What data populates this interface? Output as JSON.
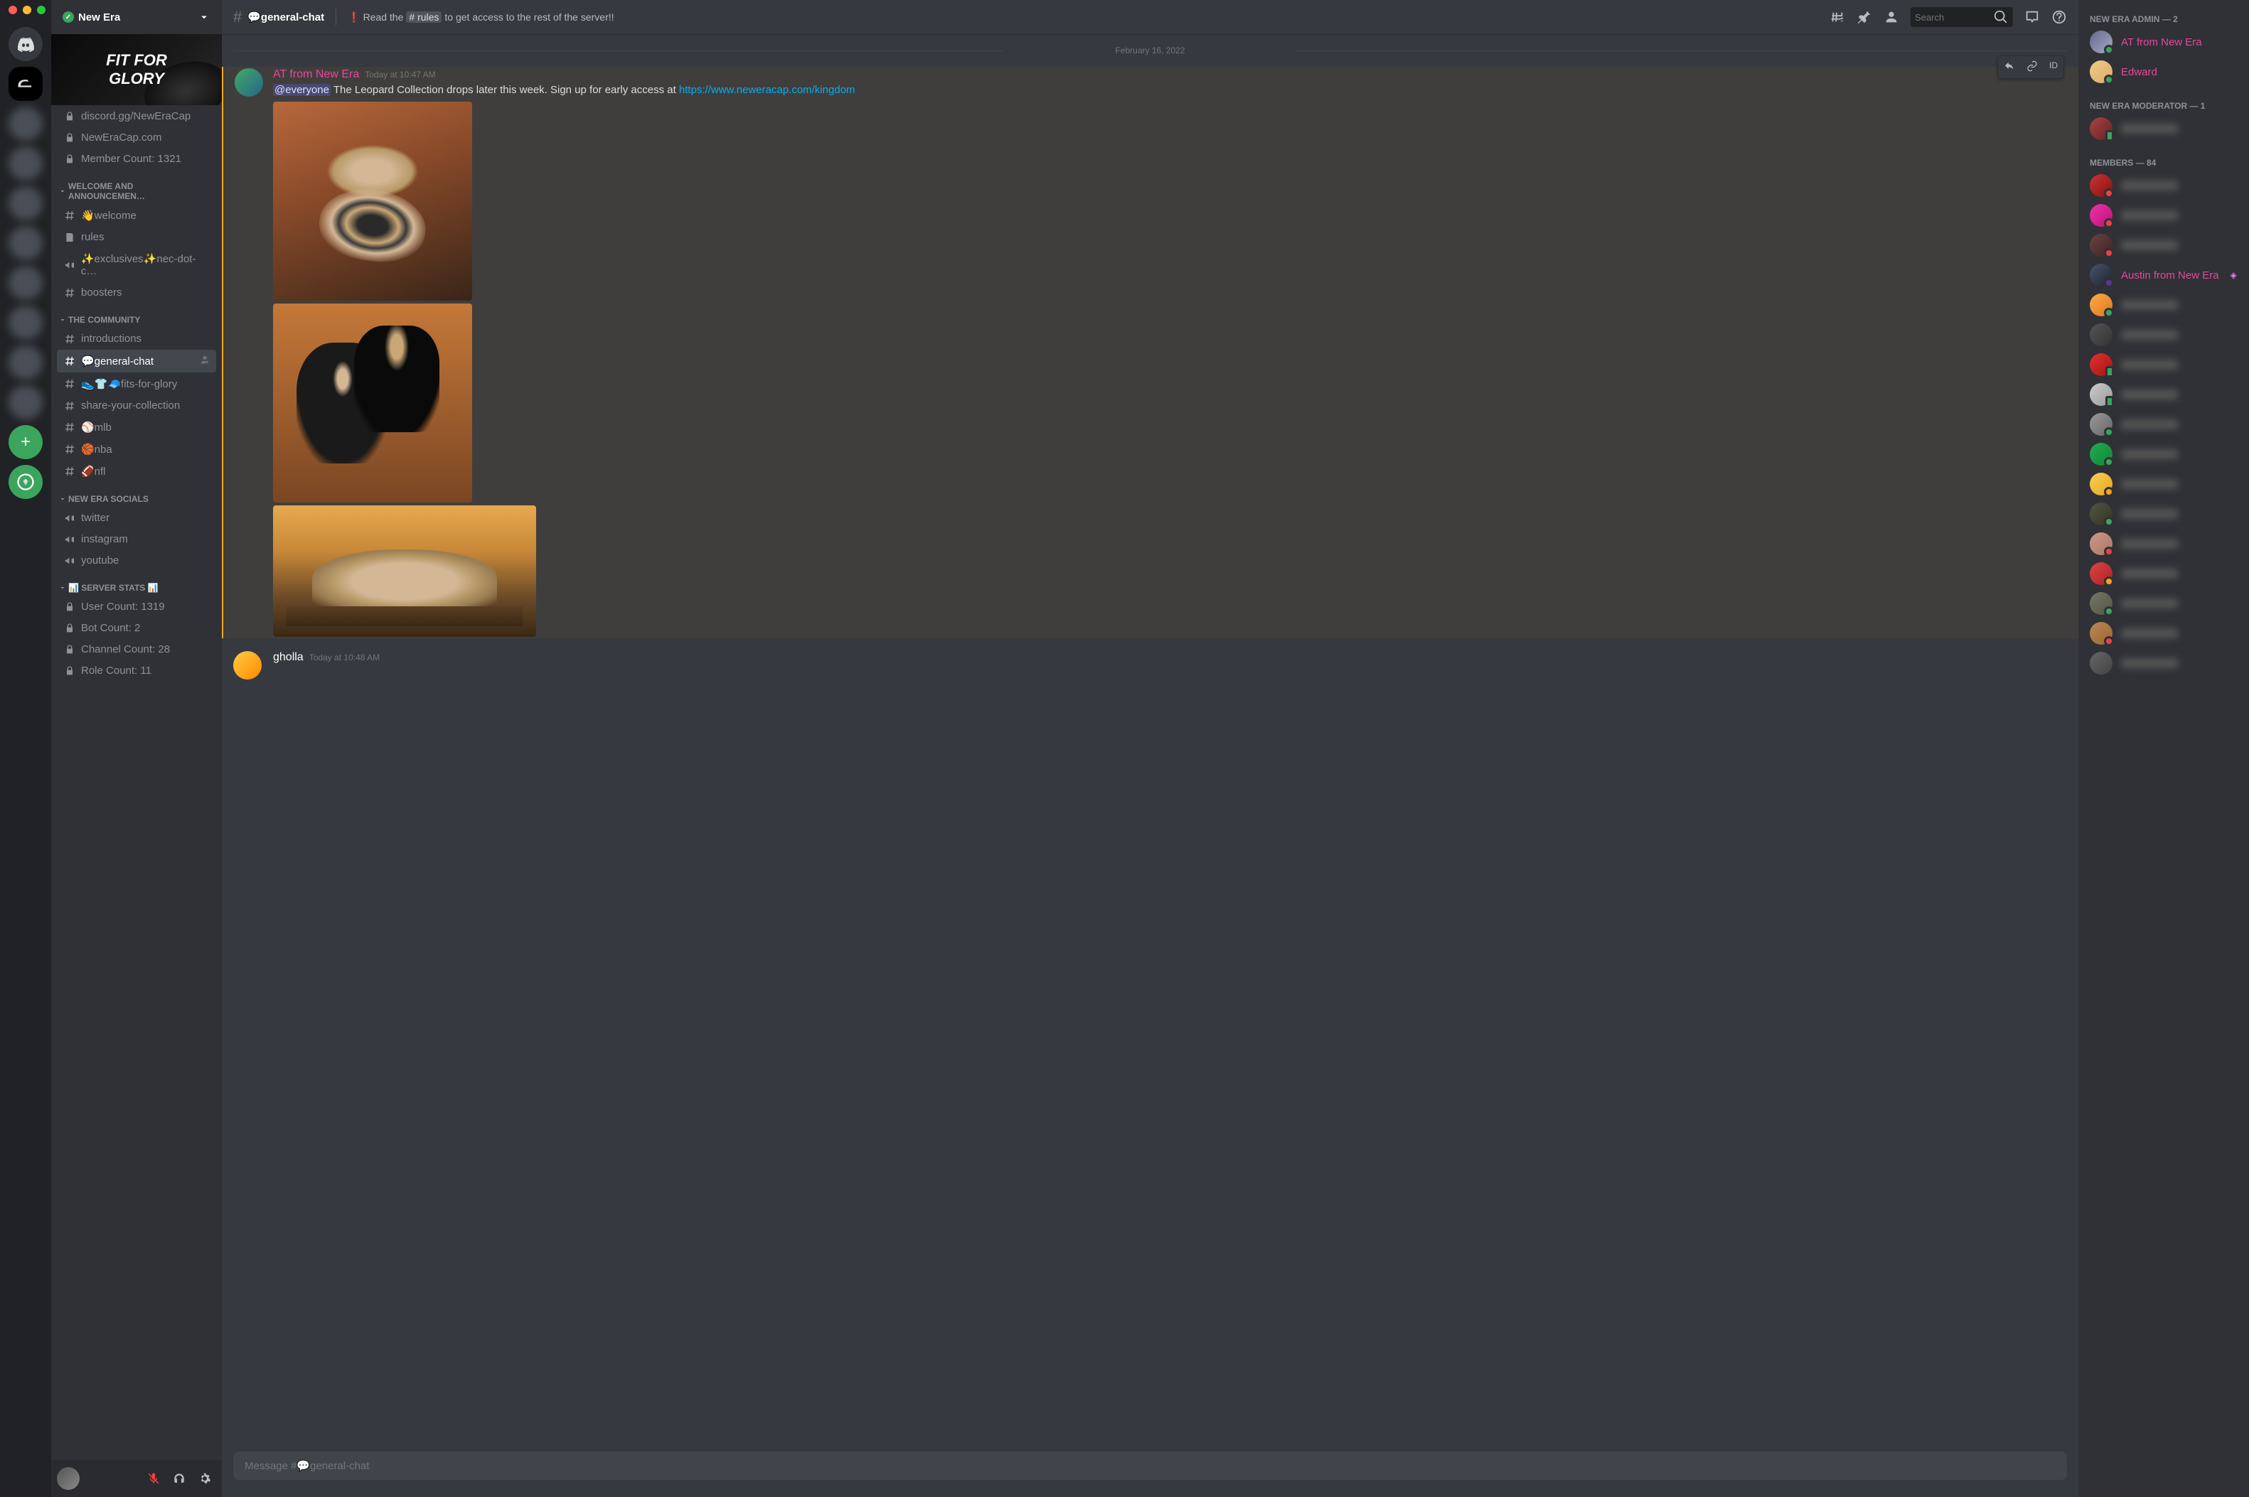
{
  "window": {
    "server_name": "New Era"
  },
  "banner_text": "FIT FOR\nGLORY",
  "categories": [
    {
      "name": "",
      "channels": [
        {
          "label": "discord.gg/NewEraCap",
          "icon": "lock"
        },
        {
          "label": "NewEraCap.com",
          "icon": "lock"
        },
        {
          "label": "Member Count: 1321",
          "icon": "lock"
        }
      ]
    },
    {
      "name": "WELCOME AND ANNOUNCEMEN…",
      "channels": [
        {
          "label": "👋welcome",
          "icon": "hash"
        },
        {
          "label": "rules",
          "icon": "rules"
        },
        {
          "label": "✨exclusives✨nec-dot-c…",
          "icon": "mega"
        },
        {
          "label": "boosters",
          "icon": "hash"
        }
      ]
    },
    {
      "name": "THE COMMUNITY",
      "channels": [
        {
          "label": "introductions",
          "icon": "hash"
        },
        {
          "label": "💬general-chat",
          "icon": "hash",
          "selected": true,
          "add": true
        },
        {
          "label": "👟👕🧢fits-for-glory",
          "icon": "hash"
        },
        {
          "label": "share-your-collection",
          "icon": "hash"
        },
        {
          "label": "⚾mlb",
          "icon": "hash"
        },
        {
          "label": "🏀nba",
          "icon": "hash"
        },
        {
          "label": "🏈nfl",
          "icon": "hash"
        }
      ]
    },
    {
      "name": "NEW ERA SOCIALS",
      "channels": [
        {
          "label": "twitter",
          "icon": "mega"
        },
        {
          "label": "instagram",
          "icon": "mega"
        },
        {
          "label": "youtube",
          "icon": "mega"
        }
      ]
    },
    {
      "name": "📊 SERVER STATS 📊",
      "channels": [
        {
          "label": "User Count: 1319",
          "icon": "lock"
        },
        {
          "label": "Bot Count: 2",
          "icon": "lock"
        },
        {
          "label": "Channel Count: 28",
          "icon": "lock"
        },
        {
          "label": "Role Count: 11",
          "icon": "lock"
        }
      ]
    }
  ],
  "header": {
    "channel": "💬general-chat",
    "topic_pre": "Read the",
    "topic_tag": "# rules",
    "topic_post": "to get access to the rest of the server!!",
    "search_placeholder": "Search"
  },
  "divider_date": "February 16, 2022",
  "message1": {
    "author": "AT from New Era",
    "timestamp": "Today at 10:47 AM",
    "mention": "@everyone",
    "body": " The Leopard Collection drops later this week. Sign up for early access at ",
    "link": "https://www.neweracap.com/kingdom"
  },
  "message2": {
    "author": "gholla",
    "timestamp": "Today at 10:48 AM"
  },
  "input_placeholder": "Message #💬general-chat",
  "member_groups": [
    {
      "title": "NEW ERA ADMIN — 2",
      "members": [
        {
          "name": "AT from New Era",
          "color": "pink",
          "status": "on",
          "av": "linear-gradient(135deg,#668,#aac)"
        },
        {
          "name": "Edward",
          "color": "pink",
          "status": "on",
          "av": "linear-gradient(135deg,#ec8,#da6)"
        }
      ]
    },
    {
      "title": "NEW ERA MODERATOR — 1",
      "members": [
        {
          "name": "",
          "blur": true,
          "status": "mob",
          "av": "linear-gradient(135deg,#a44,#622)"
        }
      ]
    },
    {
      "title": "MEMBERS — 84",
      "members": [
        {
          "blur": true,
          "status": "dnd",
          "av": "linear-gradient(135deg,#c33,#811)"
        },
        {
          "blur": true,
          "status": "dnd",
          "av": "linear-gradient(135deg,#e3a,#b17)"
        },
        {
          "blur": true,
          "status": "dnd",
          "av": "linear-gradient(135deg,#644,#422)"
        },
        {
          "name": "Austin from New Era",
          "color": "pink",
          "status": "stream",
          "nitro": true,
          "av": "linear-gradient(135deg,#456,#223)"
        },
        {
          "blur": true,
          "status": "on",
          "av": "linear-gradient(135deg,#fa4,#d72)"
        },
        {
          "blur": true,
          "status": "",
          "av": "linear-gradient(135deg,#555,#333)"
        },
        {
          "blur": true,
          "status": "mob",
          "av": "linear-gradient(135deg,#d33,#a11)"
        },
        {
          "blur": true,
          "status": "mob",
          "av": "linear-gradient(135deg,#ccc,#999)"
        },
        {
          "blur": true,
          "status": "on",
          "av": "linear-gradient(135deg,#999,#666)"
        },
        {
          "blur": true,
          "status": "on",
          "av": "linear-gradient(135deg,#2a5,#183)"
        },
        {
          "blur": true,
          "status": "idle",
          "av": "linear-gradient(135deg,#fc5,#da2)"
        },
        {
          "blur": true,
          "status": "on",
          "av": "linear-gradient(135deg,#554,#332)"
        },
        {
          "blur": true,
          "status": "dnd",
          "av": "linear-gradient(135deg,#c98,#a76)"
        },
        {
          "blur": true,
          "status": "idle",
          "av": "linear-gradient(135deg,#d44,#a22)"
        },
        {
          "blur": true,
          "status": "on",
          "av": "linear-gradient(135deg,#776,#554)"
        },
        {
          "blur": true,
          "status": "dnd",
          "av": "linear-gradient(135deg,#b85,#963)"
        },
        {
          "blur": true,
          "status": "",
          "av": "linear-gradient(135deg,#666,#444)"
        }
      ]
    }
  ],
  "msg_tool_id": "ID"
}
